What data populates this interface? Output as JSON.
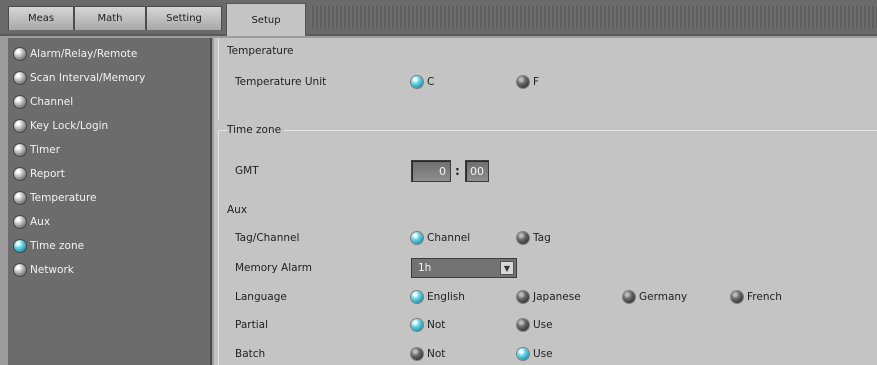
{
  "tabs": [
    {
      "label": "Meas"
    },
    {
      "label": "Math"
    },
    {
      "label": "Setting"
    },
    {
      "label": "Setup"
    }
  ],
  "sidebar": {
    "items": [
      {
        "label": "Alarm/Relay/Remote",
        "icon": "gray-bullet-icon"
      },
      {
        "label": "Scan Interval/Memory",
        "icon": "gray-bullet-icon"
      },
      {
        "label": "Channel",
        "icon": "gray-bullet-icon"
      },
      {
        "label": "Key Lock/Login",
        "icon": "gray-bullet-icon"
      },
      {
        "label": "Timer",
        "icon": "gray-bullet-icon"
      },
      {
        "label": "Report",
        "icon": "gray-bullet-icon"
      },
      {
        "label": "Temperature",
        "icon": "gray-bullet-icon"
      },
      {
        "label": "Aux",
        "icon": "gray-bullet-icon"
      },
      {
        "label": "Time zone",
        "icon": "cyan-bullet-icon",
        "selected": true
      },
      {
        "label": "Network",
        "icon": "gray-bullet-icon"
      }
    ]
  },
  "temperature": {
    "title": "Temperature",
    "unit_label": "Temperature Unit",
    "options": [
      "C",
      "F"
    ],
    "selected": "C"
  },
  "timezone": {
    "title": "Time zone",
    "gmt_label": "GMT",
    "hours": "0",
    "separator": ":",
    "minutes": "00"
  },
  "aux": {
    "title": "Aux",
    "tag_channel": {
      "label": "Tag/Channel",
      "options": [
        "Channel",
        "Tag"
      ],
      "selected": "Channel"
    },
    "memory_alarm": {
      "label": "Memory Alarm",
      "value": "1h",
      "arrow": "▼"
    },
    "language": {
      "label": "Language",
      "options": [
        "English",
        "Japanese",
        "Germany",
        "French"
      ],
      "selected": "English"
    },
    "partial": {
      "label": "Partial",
      "options": [
        "Not",
        "Use"
      ],
      "selected": "Not"
    },
    "batch": {
      "label": "Batch",
      "options": [
        "Not",
        "Use"
      ],
      "selected": "Use"
    }
  },
  "colors": {
    "accent_selected": "#2aa6c0",
    "sidebar_bg": "#6c6c6c",
    "panel_bg": "#c4c4c4"
  }
}
